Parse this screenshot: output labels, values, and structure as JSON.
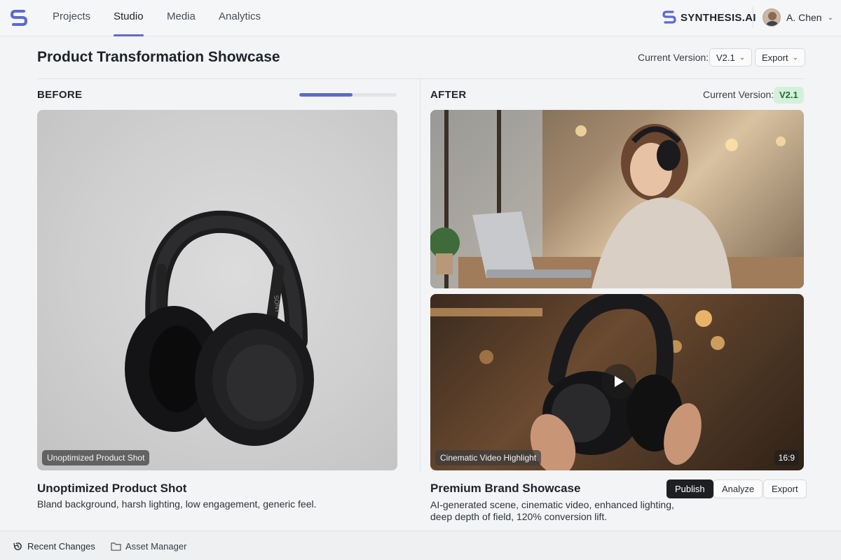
{
  "nav": {
    "tabs": [
      {
        "label": "Projects"
      },
      {
        "label": "Studio"
      },
      {
        "label": "Media"
      },
      {
        "label": "Analytics"
      }
    ],
    "active_tab": "Studio",
    "brand": "SYNTHESIS.AI",
    "user_name": "A. Chen"
  },
  "header": {
    "title": "Product Transformation Showcase",
    "version_label": "Current Version:",
    "version_value": "V2.1",
    "export_label": "Export"
  },
  "before": {
    "label": "BEFORE",
    "progress": 0.55,
    "caption": "Unoptimized Product Shot",
    "title": "Unoptimized Product Shot",
    "description": "Bland background, harsh lighting, low engagement, generic feel."
  },
  "after": {
    "label": "AFTER",
    "version_label": "Current Version:",
    "version_badge": "V2.1",
    "video_caption": "Cinematic Video Highlight",
    "aspect_ratio": "16:9",
    "title": "Premium Brand Showcase",
    "description_line1": "AI-generated scene, cinematic video, enhanced lighting,",
    "description_line2": "deep depth of field, 120% conversion lift.",
    "buttons": {
      "publish": "Publish",
      "analyze": "Analyze",
      "export": "Export"
    }
  },
  "footer": {
    "recent_changes": "Recent Changes",
    "asset_manager": "Asset Manager"
  },
  "colors": {
    "accent": "#5b6ad0",
    "badge_bg": "#d4f0d9",
    "badge_text": "#1e6b34"
  }
}
